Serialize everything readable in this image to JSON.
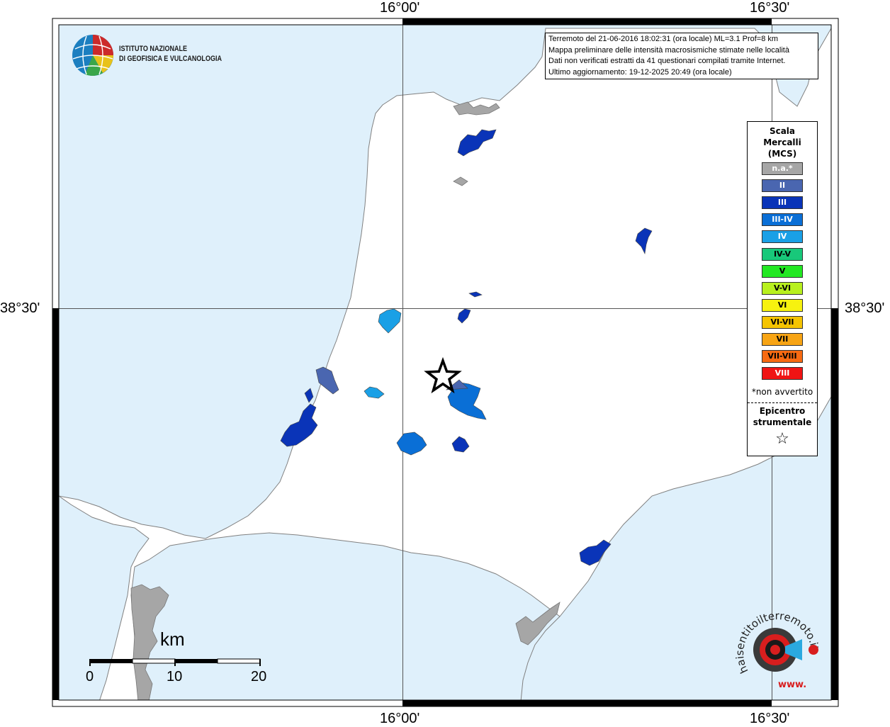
{
  "map": {
    "coord_labels": {
      "lon_top_left": "16°00'",
      "lon_top_right": "16°30'",
      "lon_bottom_left": "16°00'",
      "lon_bottom_right": "16°30'",
      "lat_left": "38°30'",
      "lat_right": "38°30'"
    },
    "colors": {
      "sea": "#dff0fb",
      "land": "#ffffff",
      "urban_na": "#a6a6a6",
      "epicenter_star": "#000000"
    }
  },
  "info": {
    "line1": "Terremoto del 21-06-2016 18:02:31 (ora locale) ML=3.1 Prof=8 km",
    "line2": "Mappa preliminare delle intensità macrosismiche stimate nelle località",
    "line3": "Dati non verificati estratti da 41 questionari compilati tramite Internet.",
    "line4": "Ultimo aggiornamento: 19-12-2025 20:49 (ora locale)"
  },
  "legend": {
    "title_line1": "Scala",
    "title_line2": "Mercalli",
    "title_line3": "(MCS)",
    "items": [
      {
        "label": "n.a.*",
        "color": "#a6a6a6",
        "text_color": "#ffffff"
      },
      {
        "label": "II",
        "color": "#4a66b0",
        "text_color": "#ffffff"
      },
      {
        "label": "III",
        "color": "#0a34b8",
        "text_color": "#ffffff"
      },
      {
        "label": "III-IV",
        "color": "#0a6fd6",
        "text_color": "#ffffff"
      },
      {
        "label": "IV",
        "color": "#1aa0e6",
        "text_color": "#ffffff"
      },
      {
        "label": "IV-V",
        "color": "#18c87a",
        "text_color": "#000000"
      },
      {
        "label": "V",
        "color": "#22e822",
        "text_color": "#000000"
      },
      {
        "label": "V-VI",
        "color": "#b8f01e",
        "text_color": "#000000"
      },
      {
        "label": "VI",
        "color": "#f7f20f",
        "text_color": "#000000"
      },
      {
        "label": "VI-VII",
        "color": "#f5c400",
        "text_color": "#000000"
      },
      {
        "label": "VII",
        "color": "#f7a414",
        "text_color": "#000000"
      },
      {
        "label": "VII-VIII",
        "color": "#f76a12",
        "text_color": "#000000"
      },
      {
        "label": "VIII",
        "color": "#f01414",
        "text_color": "#ffffff"
      }
    ],
    "note": "*non avvertito",
    "epicenter_line1": "Epicentro",
    "epicenter_line2": "strumentale",
    "epicenter_symbol": "☆"
  },
  "ingv": {
    "line1": "ISTITUTO NAZIONALE",
    "line2": "DI GEOFISICA E VULCANOLOGIA"
  },
  "scale_bar": {
    "unit": "km",
    "ticks": [
      "0",
      "10",
      "20"
    ]
  },
  "haisentito": {
    "text": "haisentitoilterremoto.it",
    "text_www": "www."
  }
}
